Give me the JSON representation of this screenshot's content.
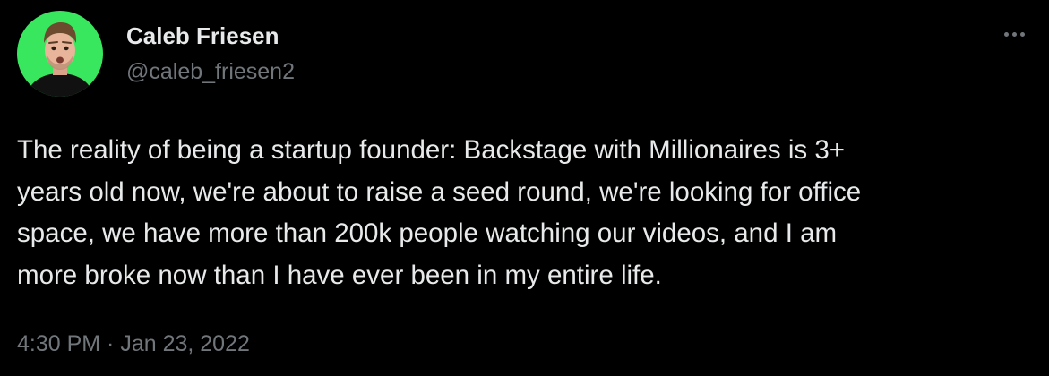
{
  "tweet": {
    "author": {
      "name": "Caleb Friesen",
      "handle": "@caleb_friesen2",
      "avatar_bg": "#39e75f"
    },
    "more_icon": "more-horizontal-icon",
    "text_lines": [
      "The reality of being a startup founder: Backstage with Millionaires is 3+",
      "years old now, we're about to raise a seed round, we're looking for office",
      "space, we have more than 200k people watching our videos, and I am",
      "more broke now than I have ever been in my entire life."
    ],
    "timestamp": "4:30 PM · Jan 23, 2022"
  },
  "colors": {
    "background": "#000000",
    "primary_text": "#e7e9ea",
    "secondary_text": "#71767b"
  }
}
